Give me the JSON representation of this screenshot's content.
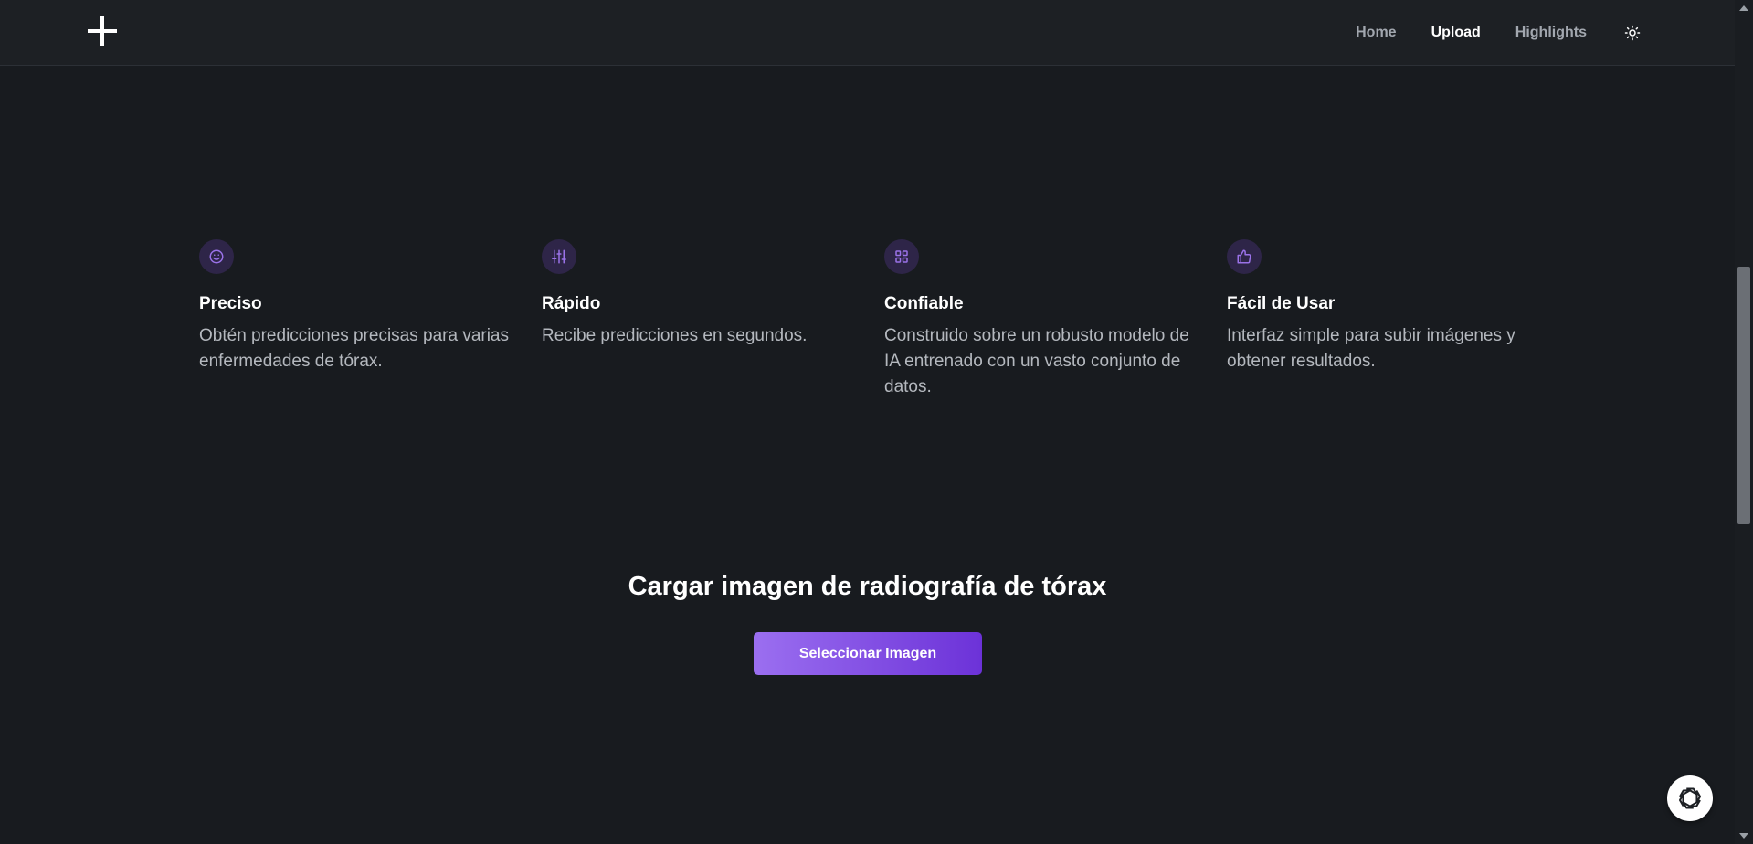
{
  "nav": {
    "home": "Home",
    "upload": "Upload",
    "highlights": "Highlights"
  },
  "features": [
    {
      "icon": "smile-icon",
      "title": "Preciso",
      "description": "Obtén predicciones precisas para varias enfermedades de tórax."
    },
    {
      "icon": "sliders-icon",
      "title": "Rápido",
      "description": "Recibe predicciones en segundos."
    },
    {
      "icon": "grid-icon",
      "title": "Confiable",
      "description": "Construido sobre un robusto modelo de IA entrenado con un vasto conjunto de datos."
    },
    {
      "icon": "thumbs-up-icon",
      "title": "Fácil de Usar",
      "description": "Interfaz simple para subir imágenes y obtener resultados."
    }
  ],
  "upload": {
    "title": "Cargar imagen de radiografía de tórax",
    "button_label": "Seleccionar Imagen"
  },
  "colors": {
    "background": "#181b1f",
    "header": "#1d2024",
    "accent_start": "#9b6ff0",
    "accent_end": "#6c32d8",
    "icon_bg": "#2e2548",
    "icon_stroke": "#9a72e8"
  }
}
